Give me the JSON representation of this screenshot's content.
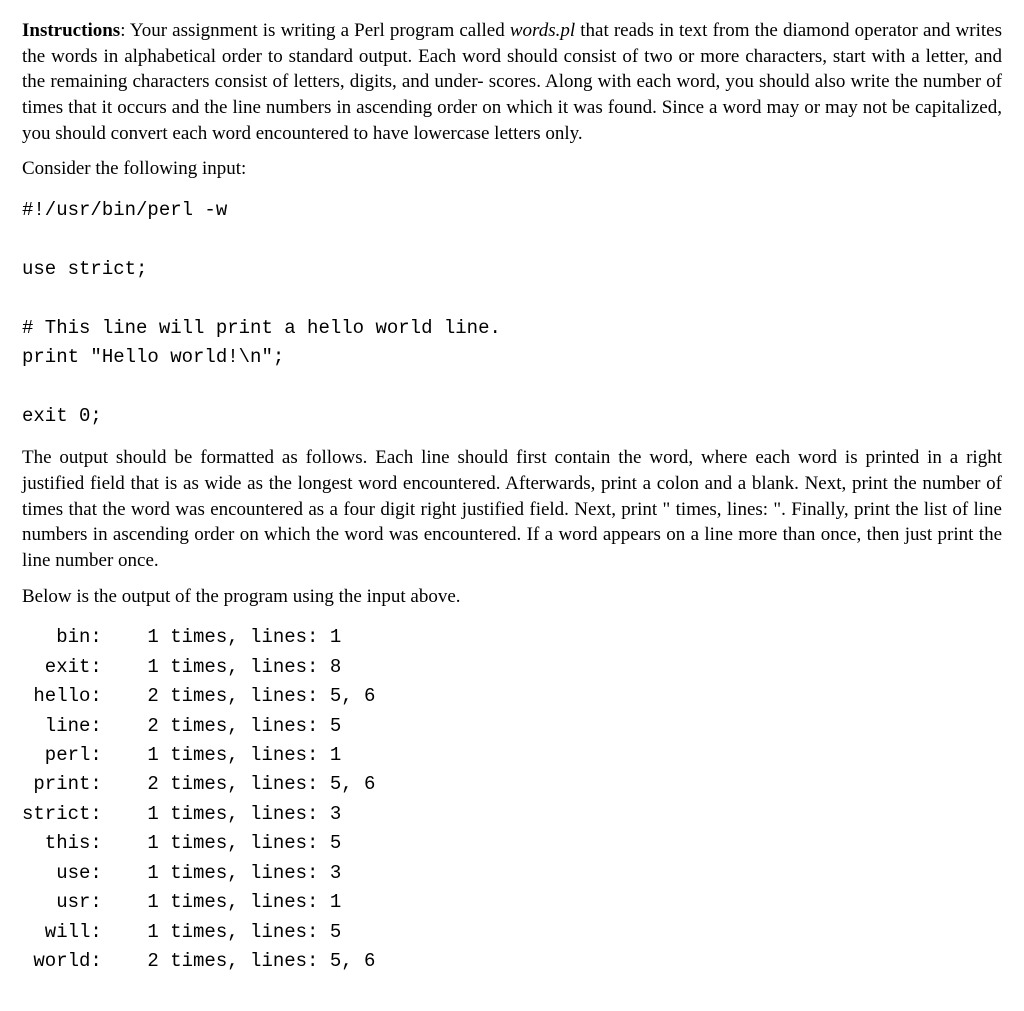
{
  "para1": {
    "label": "Instructions",
    "sep": ": ",
    "t1": "Your assignment is writing a Perl program called ",
    "fname": "words.pl",
    "t2": " that reads in text from the diamond operator and writes the words in alphabetical order to standard output.  Each word should consist of two or more characters, start with a letter, and the remaining characters consist of letters, digits, and under- scores. Along with each word, you should also write the number of times that it occurs and the line numbers in ascending order on which it was found. Since a word may or may not be capitalized, you should convert each word encountered to have lowercase letters only."
  },
  "para2": "Consider the following input:",
  "input_code": "#!/usr/bin/perl -w\n\nuse strict;\n\n# This line will print a hello world line.\nprint \"Hello world!\\n\";\n\nexit 0;",
  "para3": "The output should be formatted as follows. Each line should first contain the word, where each word is printed in a right justified field that is as wide as the longest word encountered. Afterwards, print a colon and a blank. Next, print the number of times that the word was encountered as a four digit right justified field. Next, print \" times, lines: \". Finally, print the list of line numbers in ascending order on which the word was encountered. If a word appears on a line more than once, then just print the line number once.",
  "para4": "Below is the output of the program using the input above.",
  "output_code": "   bin:    1 times, lines: 1\n  exit:    1 times, lines: 8\n hello:    2 times, lines: 5, 6\n  line:    2 times, lines: 5\n  perl:    1 times, lines: 1\n print:    2 times, lines: 5, 6\nstrict:    1 times, lines: 3\n  this:    1 times, lines: 5\n   use:    1 times, lines: 3\n   usr:    1 times, lines: 1\n  will:    1 times, lines: 5\n world:    2 times, lines: 5, 6"
}
